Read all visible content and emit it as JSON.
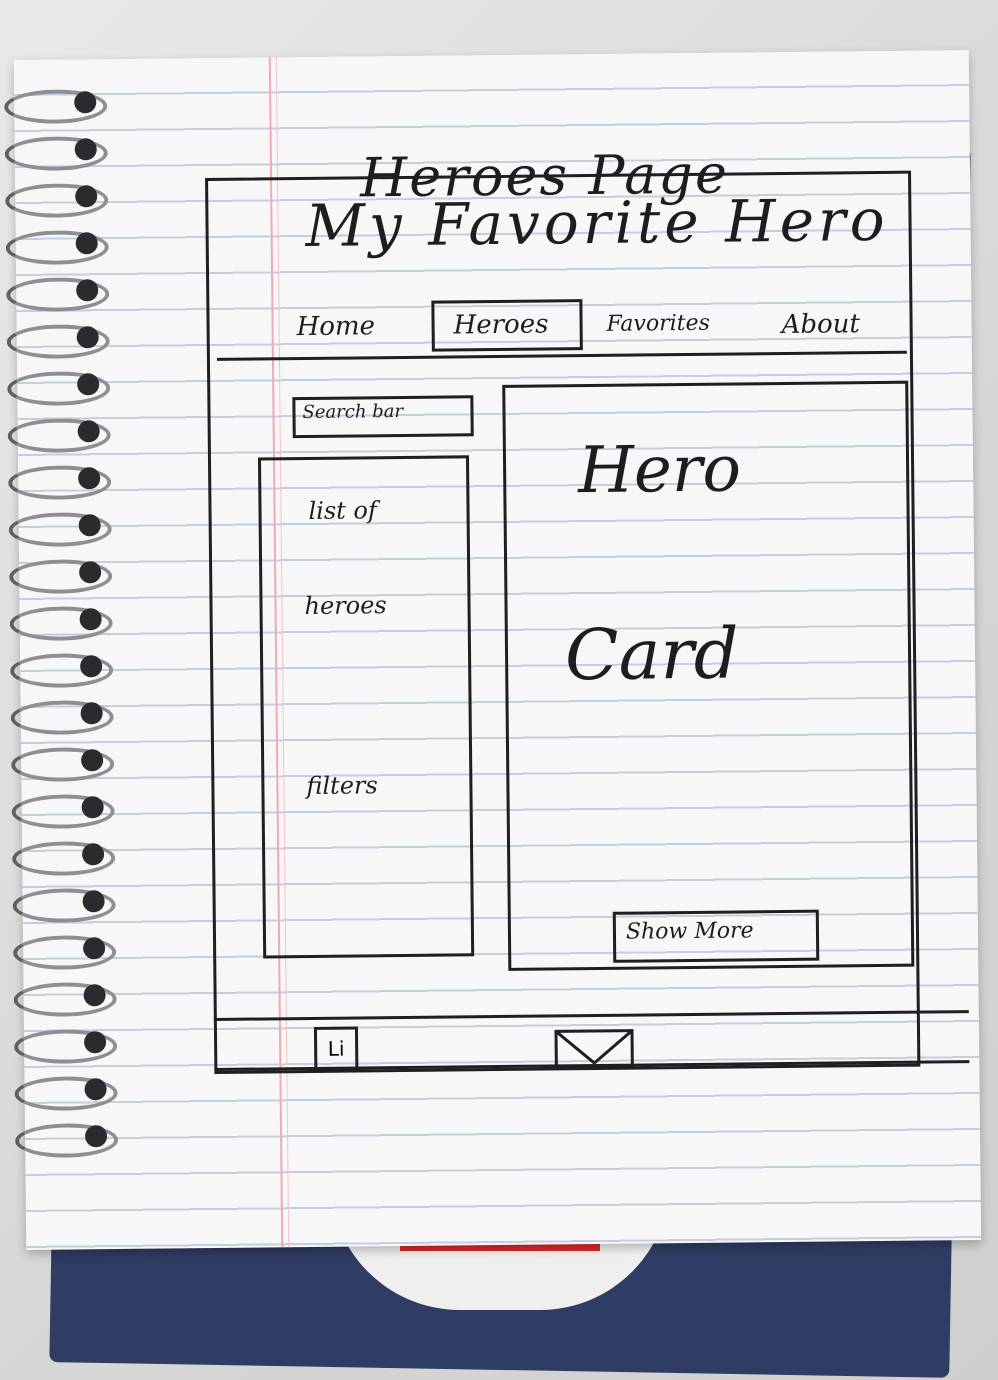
{
  "sketch": {
    "heading": "Heroes Page",
    "app_title": "My Favorite Hero",
    "nav": {
      "items": [
        {
          "label": "Home"
        },
        {
          "label": "Heroes",
          "selected": true
        },
        {
          "label": "Favorites"
        },
        {
          "label": "About"
        }
      ]
    },
    "sidebar": {
      "search_label": "Search bar",
      "list_line1": "list of",
      "list_line2": "heroes",
      "filters_label": "filters"
    },
    "card": {
      "line1": "Hero",
      "line2": "Card",
      "show_more_label": "Show More"
    },
    "footer": {
      "icons": [
        "linkedin-icon",
        "mail-icon"
      ],
      "linkedin_glyph": "Li"
    }
  },
  "colors": {
    "ink": "#1d1d1f",
    "paper": "#f7f7f8",
    "rule": "#c7cde0",
    "margin": "#f0a9b5",
    "cover": "#2f3c63"
  }
}
